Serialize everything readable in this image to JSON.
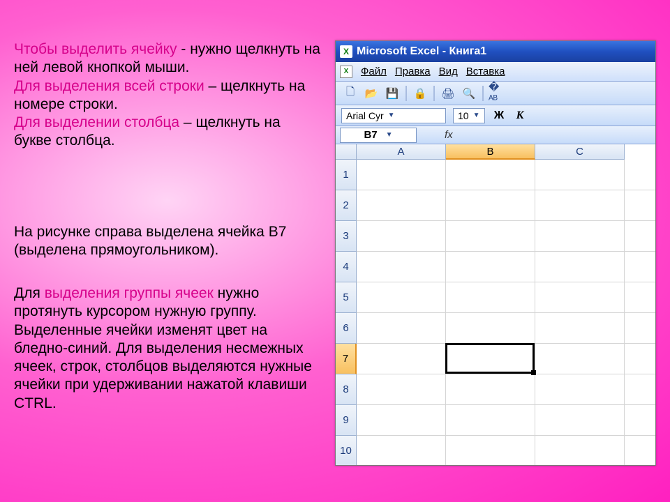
{
  "text": {
    "para1": {
      "l1a": "Чтобы выделить ячейку",
      "l1b": "  -  нужно щелкнуть на ней левой кнопкой мыши.",
      "l2a": "Для выделения всей строки",
      "l2b": " – щелкнуть на номере строки.",
      "l3a": "Для выделении столбца",
      "l3b": " – щелкнуть на букве столбца."
    },
    "para2": "На рисунке справа выделена ячейка B7 (выделена прямоугольником).",
    "para3": {
      "a": "Для ",
      "b": "выделения группы ячеек",
      "c": " нужно протянуть курсором нужную группу. Выделенные ячейки изменят цвет на бледно-синий. Для выделения несмежных ячеек, строк, столбцов выделяются нужные ячейки при удерживании нажатой клавиши CTRL."
    }
  },
  "excel": {
    "title": "Microsoft Excel - Книга1",
    "menu": [
      "Файл",
      "Правка",
      "Вид",
      "Вставка"
    ],
    "font_name": "Arial Cyr",
    "font_size": "10",
    "bold_label": "Ж",
    "italic_label": "К",
    "active_cell": "B7",
    "fx_label": "fx",
    "columns": [
      "A",
      "B",
      "C"
    ],
    "selected_col_index": 1,
    "rows": [
      "1",
      "2",
      "3",
      "4",
      "5",
      "6",
      "7",
      "8",
      "9",
      "10"
    ],
    "selected_row_index": 6,
    "toolbar_icons": [
      "new-icon",
      "open-icon",
      "save-icon",
      "permission-icon",
      "print-icon",
      "print-preview-icon",
      "spelling-icon"
    ]
  }
}
